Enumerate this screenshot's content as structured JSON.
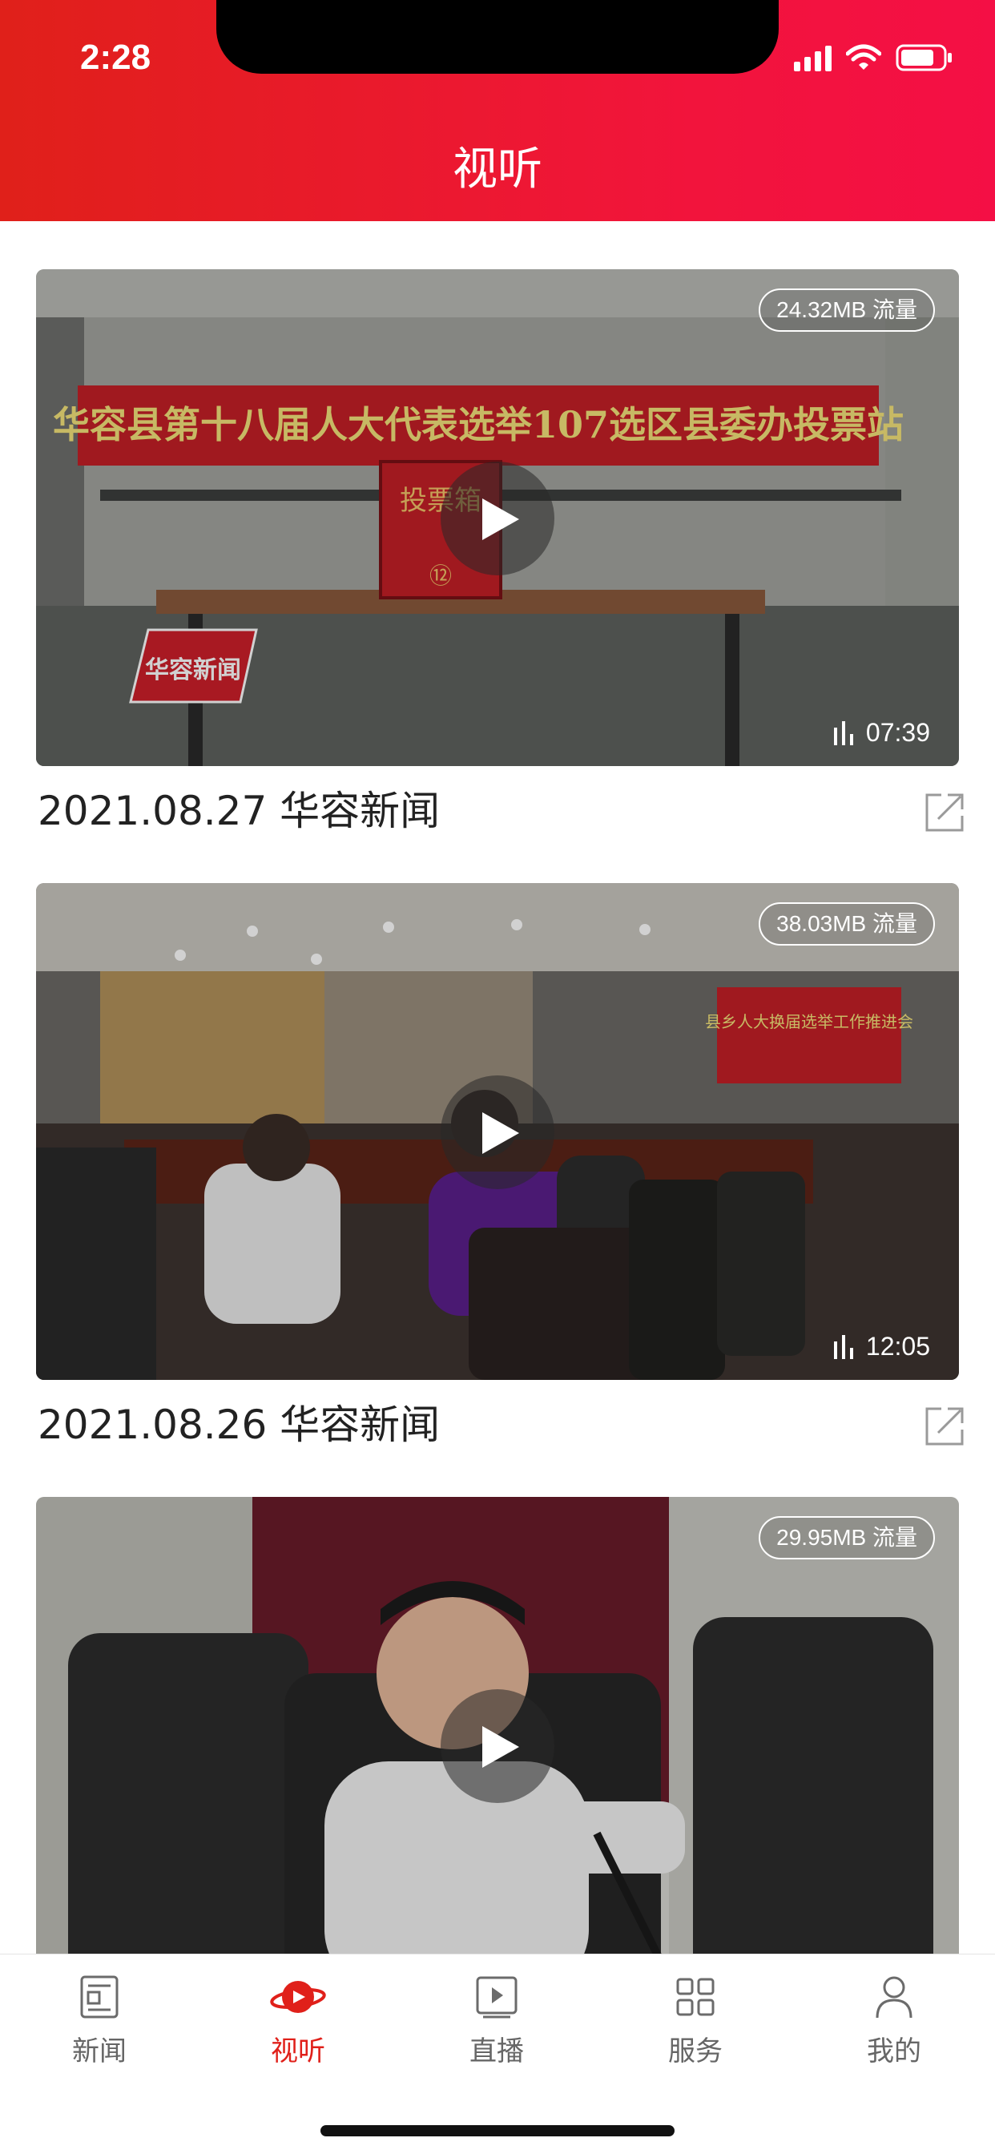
{
  "status_bar": {
    "time": "2:28"
  },
  "header": {
    "title": "视听"
  },
  "videos": [
    {
      "data_usage": "24.32MB 流量",
      "duration": "07:39",
      "title": "2021.08.27 华容新闻",
      "banner_text": "华容县第十八届人大代表选举107选区县委办投票站",
      "ballot_box_text": "投票箱",
      "ballot_box_number": "⑫",
      "watermark": "华容新闻"
    },
    {
      "data_usage": "38.03MB 流量",
      "duration": "12:05",
      "title": "2021.08.26 华容新闻",
      "banner_text": "县乡人大换届选举工作推进会"
    },
    {
      "data_usage": "29.95MB 流量"
    }
  ],
  "tabbar": {
    "items": [
      {
        "label": "新闻",
        "icon": "news-icon"
      },
      {
        "label": "视听",
        "icon": "video-planet-icon"
      },
      {
        "label": "直播",
        "icon": "live-play-icon"
      },
      {
        "label": "服务",
        "icon": "grid-service-icon"
      },
      {
        "label": "我的",
        "icon": "profile-icon"
      }
    ],
    "active_index": 1
  },
  "colors": {
    "brand_red": "#e0201a",
    "accent_pink": "#f40f45"
  }
}
